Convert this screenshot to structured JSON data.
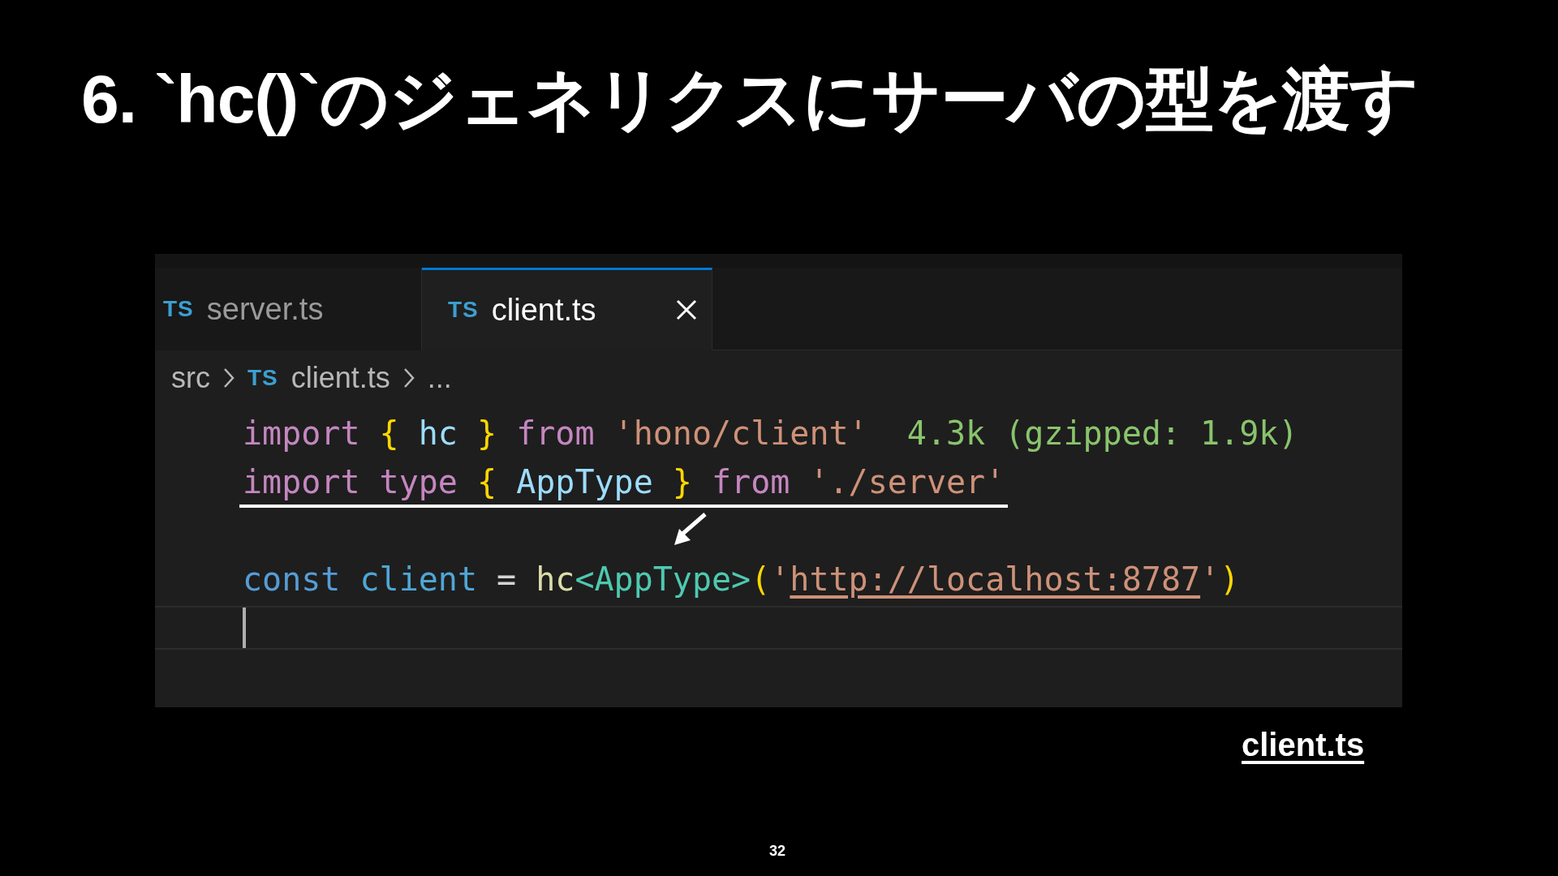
{
  "slide": {
    "title": "6. `hc()`のジェネリクスにサーバの型を渡す",
    "caption_link": "client.ts",
    "page_number": "32"
  },
  "editor": {
    "tabs": [
      {
        "badge": "TS",
        "label": "server.ts",
        "selected": false
      },
      {
        "badge": "TS",
        "label": "client.ts",
        "selected": true
      }
    ],
    "breadcrumb": [
      {
        "text": "src"
      },
      {
        "badge": "TS",
        "text": "client.ts"
      },
      {
        "text": "..."
      }
    ],
    "lines": [
      {
        "kind": "code",
        "marked": false,
        "tokens": [
          {
            "kind": "keyword",
            "text": "import"
          },
          {
            "kind": "brace",
            "text": " {"
          },
          {
            "kind": "variable",
            "text": " hc"
          },
          {
            "kind": "brace",
            "text": " }"
          },
          {
            "kind": "keyword",
            "text": " from"
          },
          {
            "kind": "string",
            "text": " 'hono/client'"
          },
          {
            "kind": "hint",
            "text": "  4.3k (gzipped: 1.9k)"
          }
        ]
      },
      {
        "kind": "code",
        "marked": true,
        "tokens": [
          {
            "kind": "keyword",
            "text": "import"
          },
          {
            "kind": "keyword",
            "text": " type"
          },
          {
            "kind": "brace",
            "text": " {"
          },
          {
            "kind": "variable",
            "text": " AppType"
          },
          {
            "kind": "brace",
            "text": " }"
          },
          {
            "kind": "keyword",
            "text": " from"
          },
          {
            "kind": "string",
            "text": " './server'"
          }
        ]
      },
      {
        "kind": "arrow"
      },
      {
        "kind": "code",
        "marked": false,
        "tokens": [
          {
            "kind": "storage",
            "text": "const"
          },
          {
            "kind": "constant",
            "text": " client"
          },
          {
            "kind": "operator",
            "text": " ="
          },
          {
            "kind": "function",
            "text": " hc"
          },
          {
            "kind": "typename",
            "text": "<AppType>"
          },
          {
            "kind": "brace",
            "text": "("
          },
          {
            "kind": "string",
            "text": "'"
          },
          {
            "kind": "url",
            "text": "http://localhost:8787"
          },
          {
            "kind": "string",
            "text": "'"
          },
          {
            "kind": "brace",
            "text": ")"
          }
        ]
      },
      {
        "kind": "cursor"
      }
    ]
  }
}
